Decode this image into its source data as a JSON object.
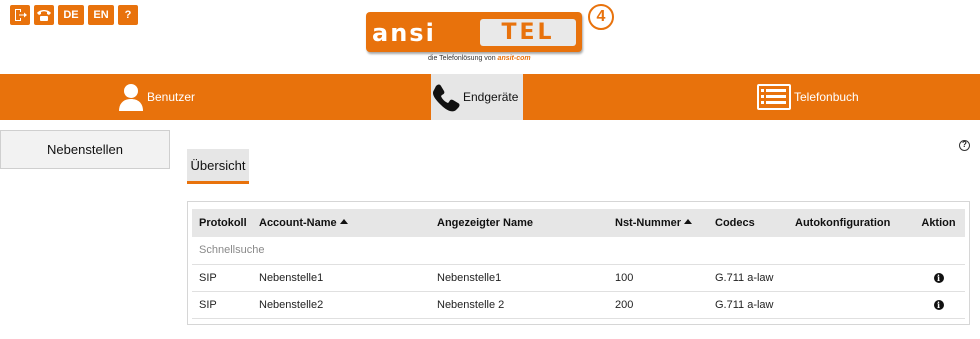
{
  "toolbar": {
    "icons": [
      {
        "name": "logout-icon"
      },
      {
        "name": "phone-icon"
      }
    ],
    "lang_de": "DE",
    "lang_en": "EN",
    "help": "?"
  },
  "logo": {
    "left_text": "ansi",
    "right_text": "TEL",
    "version": "4",
    "tagline_prefix": "die Telefonlösung von",
    "tagline_brand": "ansit-com"
  },
  "nav": {
    "users": "Benutzer",
    "devices": "Endgeräte",
    "phonebook": "Telefonbuch"
  },
  "sidebar": {
    "extensions": "Nebenstellen"
  },
  "help_icon": "?",
  "tabs": {
    "overview": "Übersicht"
  },
  "table": {
    "headers": {
      "protocol": "Protokoll",
      "account": "Account-Name",
      "display": "Angezeigter Name",
      "number": "Nst-Nummer",
      "codecs": "Codecs",
      "autoconf": "Autokonfiguration",
      "action": "Aktion"
    },
    "quick_search": "Schnellsuche",
    "rows": [
      {
        "protocol": "SIP",
        "account": "Nebenstelle1",
        "display": "Nebenstelle1",
        "number": "100",
        "codecs": "G.711 a-law",
        "autoconf": "",
        "action_icon": "i"
      },
      {
        "protocol": "SIP",
        "account": "Nebenstelle2",
        "display": "Nebenstelle 2",
        "number": "200",
        "codecs": "G.711 a-law",
        "autoconf": "",
        "action_icon": "i"
      }
    ]
  },
  "colors": {
    "accent": "#e8720c",
    "active_tab": "#e6e6e6"
  }
}
